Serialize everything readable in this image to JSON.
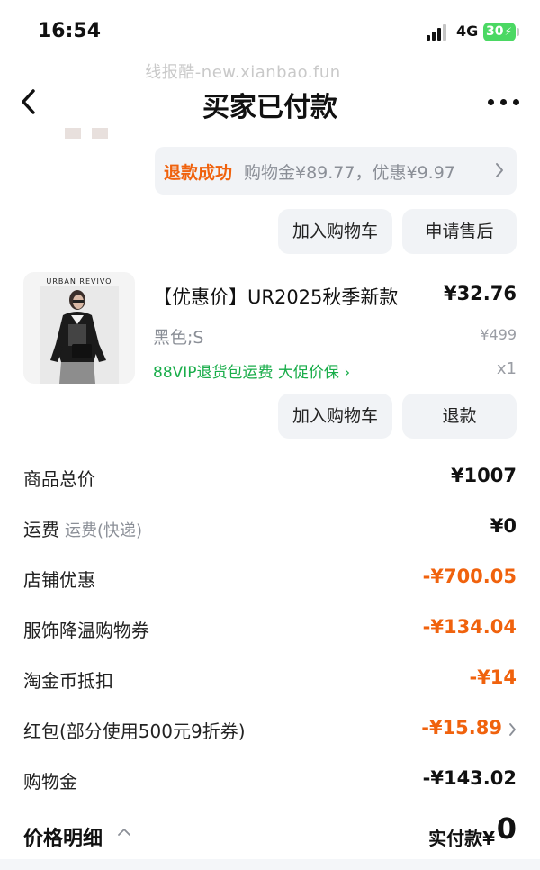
{
  "status_bar": {
    "time": "16:54",
    "network": "4G",
    "battery": "30"
  },
  "watermark": "线报酷-new.xianbao.fun",
  "header": {
    "title": "买家已付款"
  },
  "refund": {
    "status": "退款成功",
    "detail": "购物金¥89.77，优惠¥9.97"
  },
  "buttons": {
    "add_to_cart_1": "加入购物车",
    "after_sales": "申请售后",
    "add_to_cart_2": "加入购物车",
    "refund": "退款"
  },
  "product": {
    "brand": "URBAN REVIVO",
    "title": "【优惠价】UR2025秋季新款",
    "price": "¥32.76",
    "spec": "黑色;S",
    "original_price": "¥499",
    "vip_text": "88VIP退货包运费  大促价保",
    "vip_chevron": "›",
    "qty": "x1"
  },
  "summary": [
    {
      "label": "商品总价",
      "sub": "",
      "value": "¥1007",
      "highlight": false
    },
    {
      "label": "运费",
      "sub": "运费(快递)",
      "value": "¥0",
      "highlight": false
    },
    {
      "label": "店铺优惠",
      "sub": "",
      "value": "-¥700.05",
      "highlight": true
    },
    {
      "label": "服饰降温购物券",
      "sub": "",
      "value": "-¥134.04",
      "highlight": true
    },
    {
      "label": "淘金币抵扣",
      "sub": "",
      "value": "-¥14",
      "highlight": true
    },
    {
      "label": "红包(部分使用500元9折券)",
      "sub": "",
      "value": "-¥15.89",
      "highlight": true
    },
    {
      "label": "购物金",
      "sub": "",
      "value": "-¥143.02",
      "highlight": false
    }
  ],
  "footer": {
    "breakdown_label": "价格明细",
    "paid_label": "实付款¥",
    "paid_value": "0"
  },
  "colors": {
    "accent_orange": "#f0620d",
    "vip_green": "#19ad4a",
    "muted_grey": "#8b8f97",
    "pill_bg": "#f1f3f6",
    "battery_green": "#4bd863"
  }
}
